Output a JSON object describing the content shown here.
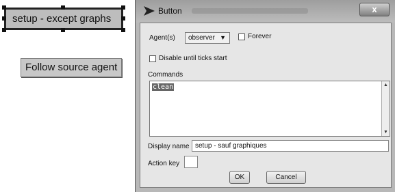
{
  "interface": {
    "setup_button_label": "setup - except graphs",
    "follow_button_label": "Follow source agent"
  },
  "dialog": {
    "title": "Button",
    "close_label": "x",
    "agents_label": "Agent(s)",
    "agents_value": "observer",
    "forever_label": "Forever",
    "forever_checked": false,
    "disable_label": "Disable until ticks start",
    "disable_checked": false,
    "commands_label": "Commands",
    "commands_value": "clean",
    "display_name_label": "Display name",
    "display_name_value": "setup - sauf graphiques",
    "action_key_label": "Action key",
    "action_key_value": "",
    "ok_label": "OK",
    "cancel_label": "Cancel"
  },
  "icons": {
    "title_logo": "netlogo-arrow-icon",
    "dropdown": "chevron-down-icon",
    "scroll_up": "scroll-up-icon",
    "scroll_down": "scroll-down-icon"
  }
}
